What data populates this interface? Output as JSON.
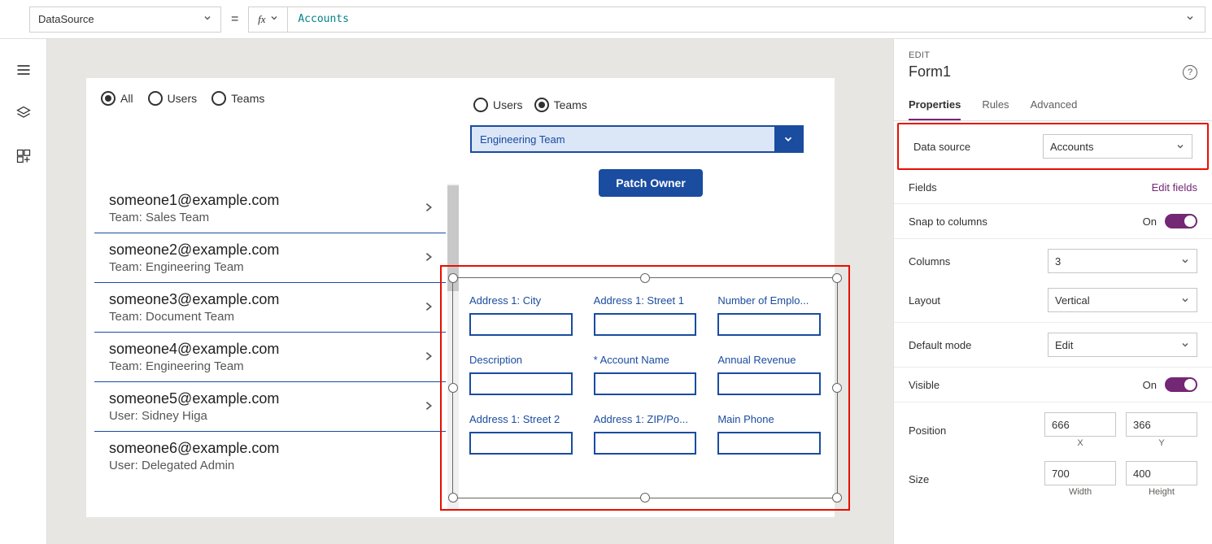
{
  "formula_bar": {
    "property": "DataSource",
    "fx_label": "fx",
    "value": "Accounts"
  },
  "canvas": {
    "radios_main": {
      "all": "All",
      "users": "Users",
      "teams": "Teams"
    },
    "list": [
      {
        "primary": "someone1@example.com",
        "secondary": "Team: Sales Team"
      },
      {
        "primary": "someone2@example.com",
        "secondary": "Team: Engineering Team"
      },
      {
        "primary": "someone3@example.com",
        "secondary": "Team: Document Team"
      },
      {
        "primary": "someone4@example.com",
        "secondary": "Team: Engineering Team"
      },
      {
        "primary": "someone5@example.com",
        "secondary": "User: Sidney Higa"
      },
      {
        "primary": "someone6@example.com",
        "secondary": "User: Delegated Admin"
      }
    ],
    "radios_sub": {
      "users": "Users",
      "teams": "Teams"
    },
    "dropdown_value": "Engineering Team",
    "patch_label": "Patch Owner",
    "form_fields": [
      {
        "label": "Address 1: City",
        "required": false
      },
      {
        "label": "Address 1: Street 1",
        "required": false
      },
      {
        "label": "Number of Emplo...",
        "required": false
      },
      {
        "label": "Description",
        "required": false
      },
      {
        "label": "Account Name",
        "required": true
      },
      {
        "label": "Annual Revenue",
        "required": false
      },
      {
        "label": "Address 1: Street 2",
        "required": false
      },
      {
        "label": "Address 1: ZIP/Po...",
        "required": false
      },
      {
        "label": "Main Phone",
        "required": false
      }
    ]
  },
  "panel": {
    "edit_label": "EDIT",
    "control_name": "Form1",
    "tabs": {
      "properties": "Properties",
      "rules": "Rules",
      "advanced": "Advanced"
    },
    "rows": {
      "data_source": {
        "label": "Data source",
        "value": "Accounts"
      },
      "fields": {
        "label": "Fields",
        "link": "Edit fields"
      },
      "snap": {
        "label": "Snap to columns",
        "state": "On"
      },
      "columns": {
        "label": "Columns",
        "value": "3"
      },
      "layout": {
        "label": "Layout",
        "value": "Vertical"
      },
      "default_mode": {
        "label": "Default mode",
        "value": "Edit"
      },
      "visible": {
        "label": "Visible",
        "state": "On"
      },
      "position": {
        "label": "Position",
        "x": "666",
        "y": "366",
        "xl": "X",
        "yl": "Y"
      },
      "size": {
        "label": "Size",
        "w": "700",
        "h": "400",
        "wl": "Width",
        "hl": "Height"
      }
    }
  }
}
